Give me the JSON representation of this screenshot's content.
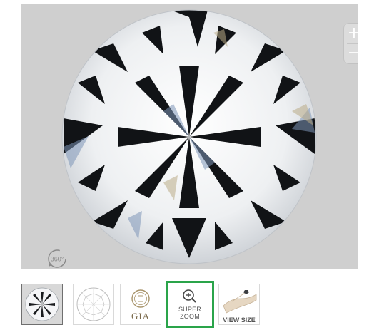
{
  "viewer": {
    "zoom_in": "+",
    "zoom_out": "−",
    "badge_360": "360°"
  },
  "thumbnails": [
    {
      "name": "diamond-photo"
    },
    {
      "name": "diamond-diagram"
    },
    {
      "name": "gia-certificate",
      "label": "GIA"
    },
    {
      "name": "super-zoom",
      "label_line1": "SUPER",
      "label_line2": "ZOOM",
      "selected": true
    },
    {
      "name": "view-size",
      "label": "VIEW SIZE"
    }
  ],
  "colors": {
    "selected_border": "#2aa44a",
    "viewer_bg": "#cfcfcf"
  }
}
